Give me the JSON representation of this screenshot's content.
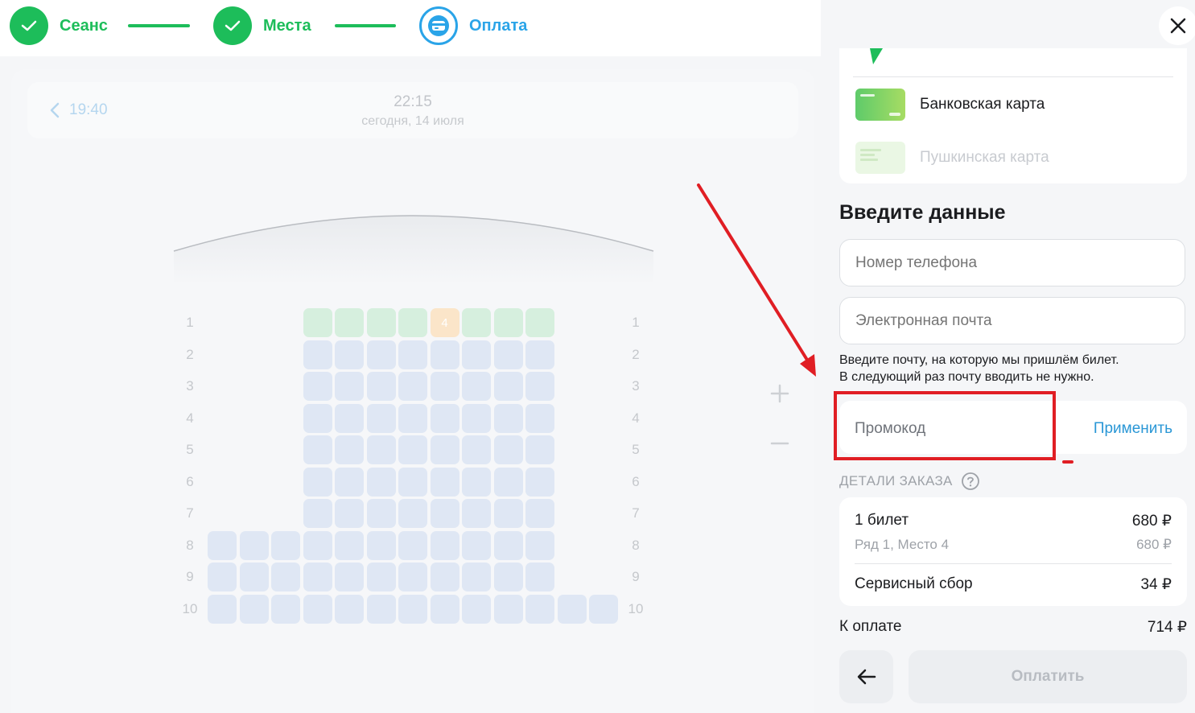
{
  "stepper": {
    "steps": [
      {
        "label": "Сеанс",
        "state": "done"
      },
      {
        "label": "Места",
        "state": "done"
      },
      {
        "label": "Оплата",
        "state": "active"
      }
    ]
  },
  "session": {
    "prev_time": "19:40",
    "current_time": "22:15",
    "date": "сегодня, 14 июля"
  },
  "hall": {
    "rows": [
      "1",
      "2",
      "3",
      "4",
      "5",
      "6",
      "7",
      "8",
      "9",
      "10"
    ],
    "selected_seat_label": "4"
  },
  "payment_methods": [
    {
      "label": "Банковская карта",
      "disabled": false
    },
    {
      "label": "Пушкинская карта",
      "disabled": true
    }
  ],
  "form": {
    "title": "Введите данные",
    "phone_placeholder": "Номер телефона",
    "email_placeholder": "Электронная почта",
    "email_hint_line1": "Введите почту, на которую мы пришлём билет.",
    "email_hint_line2": "В следующий раз почту вводить не нужно.",
    "promo_placeholder": "Промокод",
    "apply_label": "Применить"
  },
  "order": {
    "title": "ДЕТАЛИ ЗАКАЗА",
    "tickets_label": "1 билет",
    "tickets_price": "680 ₽",
    "seat_label": "Ряд 1, Место 4",
    "seat_price": "680 ₽",
    "fee_label": "Сервисный сбор",
    "fee_price": "34 ₽",
    "total_label": "К оплате",
    "total_price": "714 ₽"
  },
  "actions": {
    "pay_label": "Оплатить"
  },
  "colors": {
    "done": "#1dbd5a",
    "active": "#2aa4e8",
    "annotation": "#e01e24",
    "link": "#2a97d6"
  }
}
